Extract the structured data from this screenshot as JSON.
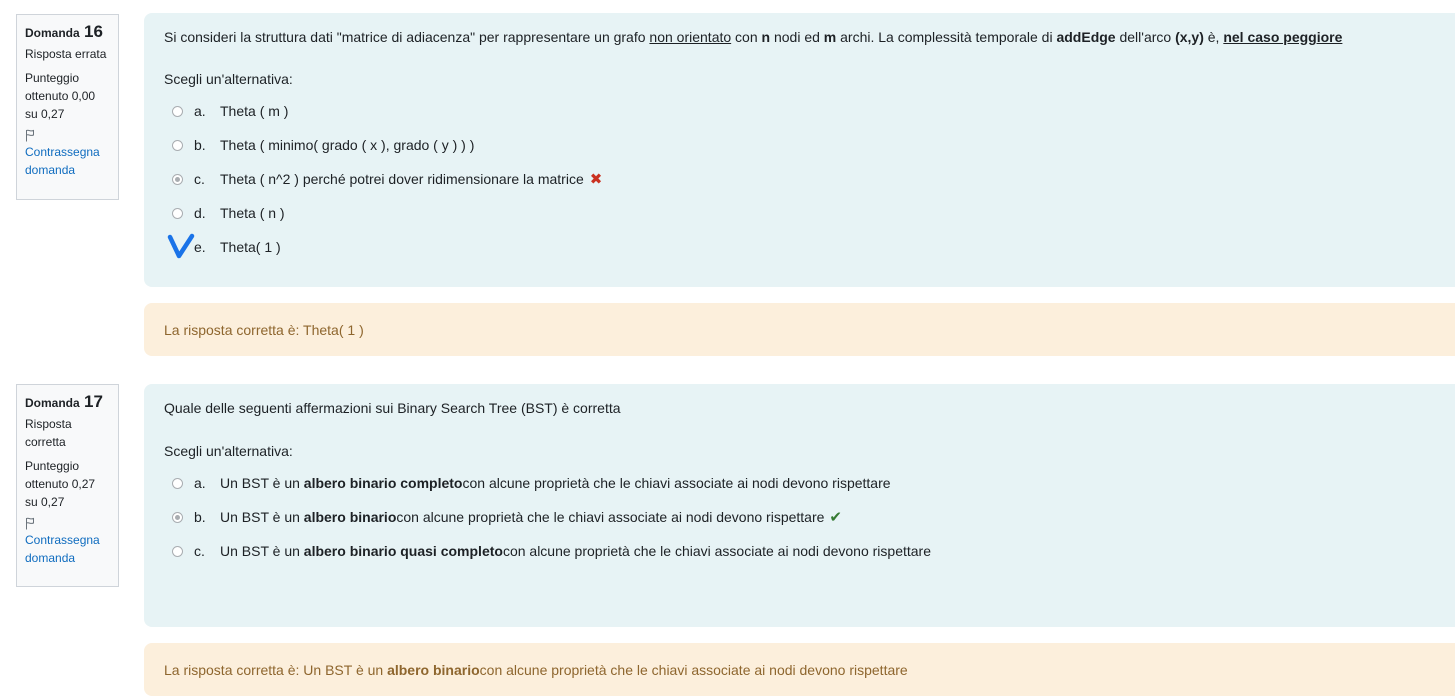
{
  "colors": {
    "info_bg": "#f8f9fa",
    "question_bg": "#e7f3f5",
    "feedback_bg": "#fcefdc",
    "feedback_text": "#8e662e",
    "link": "#0f6cbf",
    "wrong": "#ca3120",
    "right": "#357a32",
    "handwritten_check": "#1a73e8"
  },
  "q16": {
    "info": {
      "label": "Domanda",
      "number": "16",
      "state": "Risposta errata",
      "grade": "Punteggio ottenuto 0,00 su 0,27",
      "flag_label": "Contrassegna domanda",
      "flag_icon": "flag-icon"
    },
    "text": {
      "p1": "Si consideri la struttura dati \"matrice di adiacenza\" per rappresentare un grafo ",
      "u1": "non orientato",
      "p2": " con ",
      "b1": "n",
      "p3": " nodi ed ",
      "b2": "m",
      "p4": " archi. La complessità temporale di ",
      "b3": "addEdge",
      "p5": " dell'arco ",
      "b4": "(x,y)",
      "p6": " è, ",
      "bu1": "nel caso peggiore"
    },
    "prompt": "Scegli un'alternativa:",
    "options": [
      {
        "letter": "a.",
        "text": "Theta ( m )",
        "selected": false
      },
      {
        "letter": "b.",
        "text": "Theta ( minimo( grado ( x ), grado ( y ) )  )",
        "selected": false
      },
      {
        "letter": "c.",
        "text": "Theta ( n^2 ) perché potrei dover ridimensionare la matrice",
        "selected": true,
        "mark": "✖"
      },
      {
        "letter": "d.",
        "text": "Theta ( n )",
        "selected": false
      },
      {
        "letter": "e.",
        "text": "Theta( 1 )",
        "selected": false
      }
    ],
    "feedback": "La risposta corretta è: Theta( 1 )"
  },
  "q17": {
    "info": {
      "label": "Domanda",
      "number": "17",
      "state": "Risposta corretta",
      "grade": "Punteggio ottenuto 0,27 su 0,27",
      "flag_label": "Contrassegna domanda",
      "flag_icon": "flag-icon"
    },
    "text": "Quale delle seguenti affermazioni sui Binary Search Tree (BST) è corretta",
    "prompt": "Scegli un'alternativa:",
    "options": [
      {
        "letter": "a.",
        "pre": "Un BST è un ",
        "bold": "albero binario completo",
        "post": " con alcune proprietà che le chiavi associate ai nodi devono rispettare",
        "selected": false
      },
      {
        "letter": "b.",
        "pre": "Un BST è un ",
        "bold": "albero binario",
        "post": " con alcune proprietà che le chiavi associate ai nodi devono rispettare",
        "selected": true,
        "mark": "✔"
      },
      {
        "letter": "c.",
        "pre": "Un BST è un ",
        "bold": "albero binario quasi completo",
        "post": " con alcune proprietà che le chiavi associate ai nodi devono rispettare",
        "selected": false
      }
    ],
    "feedback": {
      "pre": "La risposta corretta è: Un BST è un ",
      "bold": "albero binario",
      "post": " con alcune proprietà che le chiavi associate ai nodi devono rispettare"
    }
  }
}
